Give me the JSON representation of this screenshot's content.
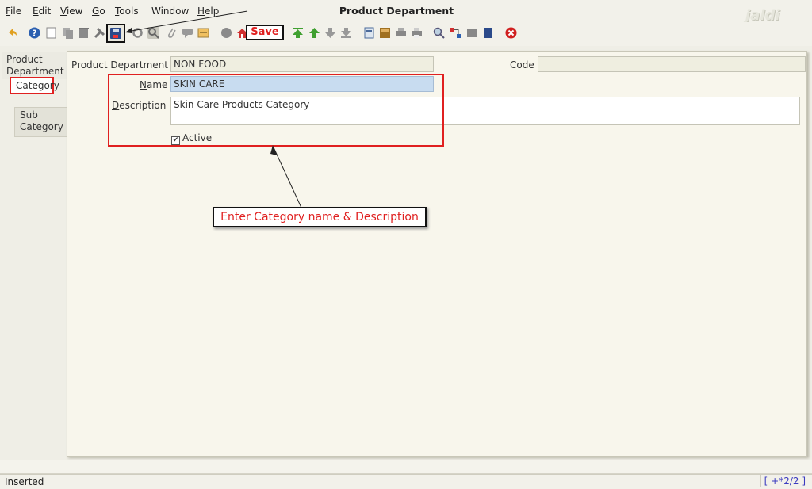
{
  "window": {
    "title": "Product Department",
    "logo": "jaldi"
  },
  "menu": [
    {
      "label": "File",
      "u": "F",
      "rest": "ile"
    },
    {
      "label": "Edit",
      "u": "E",
      "rest": "dit"
    },
    {
      "label": "View",
      "u": "V",
      "rest": "iew"
    },
    {
      "label": "Go",
      "u": "G",
      "rest": "o"
    },
    {
      "label": "Tools",
      "u": "T",
      "rest": "ools"
    },
    {
      "label": "Window",
      "u": "",
      "rest": "Window"
    },
    {
      "label": "Help",
      "u": "H",
      "rest": "elp"
    }
  ],
  "annotations": {
    "save": "Save",
    "main": "Enter Category name & Description"
  },
  "tabs": {
    "product_department": "Product Department",
    "category": "Category",
    "sub_category": "Sub Category"
  },
  "form": {
    "product_department_label": "Product Department",
    "product_department_value": "NON FOOD",
    "code_label": "Code",
    "code_value": "",
    "name_label_u": "N",
    "name_label_rest": "ame",
    "name_value": "SKIN CARE",
    "description_label_u": "D",
    "description_label_rest": "escription",
    "description_value": "Skin Care Products Category",
    "active_label": "Active",
    "active_checked": "✔"
  },
  "status": {
    "text": "Inserted",
    "record": "[ +*2/2 ]"
  },
  "colors": {
    "accent_red": "#e02020",
    "selected_field": "#c8dcf0"
  }
}
